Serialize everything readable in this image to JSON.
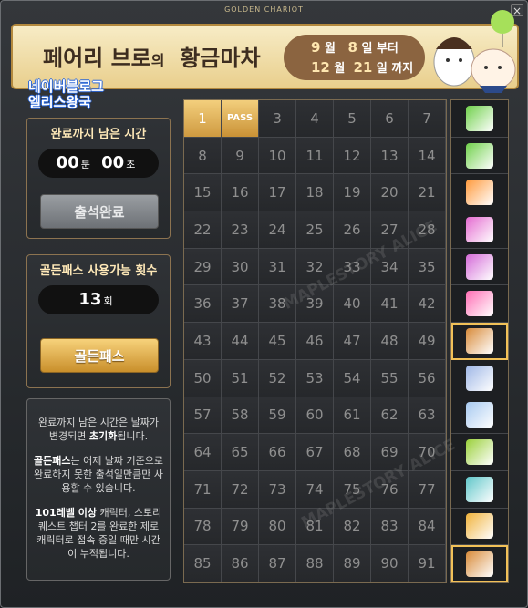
{
  "window": {
    "title": "GOLDEN CHARIOT",
    "close": "×"
  },
  "banner": {
    "title_a": "페어리 브로",
    "title_of": "의",
    "title_b": "황금마차",
    "start_month": "9",
    "start_day": "8",
    "start_suffix": "일 부터",
    "end_month": "12",
    "end_day": "21",
    "end_suffix": "일 까지",
    "month_unit": "월"
  },
  "watermark": {
    "line1": "네이버블로그",
    "line2": "엘리스왕국",
    "diag": "MAPLESTORY ALICE",
    "diag2": "네이버 블로그 엘리스왕국"
  },
  "timer_panel": {
    "heading": "완료까지 남은 시간",
    "minutes": "00",
    "minutes_unit": "분",
    "seconds": "00",
    "seconds_unit": "초",
    "button": "출석완료"
  },
  "pass_panel": {
    "heading": "골든패스 사용가능 횟수",
    "count": "13",
    "count_unit": "회",
    "button": "골든패스"
  },
  "info": {
    "p1": "완료까지 남은 시간은 날짜가 변경되면 ",
    "p1_bold": "초기화",
    "p1_end": "됩니다.",
    "p2_bold": "골든패스",
    "p2": "는 어제 날짜 기준으로 완료하지 못한 출석일만큼만 사용할 수 있습니다.",
    "p3_bold": "101레벨 이상",
    "p3": " 캐릭터, 스토리 퀘스트 챕터 2를 완료한 제로 캐릭터로 접속 중일 때만 시간이 누적됩니다."
  },
  "calendar": {
    "pass_label": "PASS",
    "days": [
      "1",
      "PASS",
      "3",
      "4",
      "5",
      "6",
      "7",
      "8",
      "9",
      "10",
      "11",
      "12",
      "13",
      "14",
      "15",
      "16",
      "17",
      "18",
      "19",
      "20",
      "21",
      "22",
      "23",
      "24",
      "25",
      "26",
      "27",
      "28",
      "29",
      "30",
      "31",
      "32",
      "33",
      "34",
      "35",
      "36",
      "37",
      "38",
      "39",
      "40",
      "41",
      "42",
      "43",
      "44",
      "45",
      "46",
      "47",
      "48",
      "49",
      "50",
      "51",
      "52",
      "53",
      "54",
      "55",
      "56",
      "57",
      "58",
      "59",
      "60",
      "61",
      "62",
      "63",
      "64",
      "65",
      "66",
      "67",
      "68",
      "69",
      "70",
      "71",
      "72",
      "73",
      "74",
      "75",
      "76",
      "77",
      "78",
      "79",
      "80",
      "81",
      "82",
      "83",
      "84",
      "85",
      "86",
      "87",
      "88",
      "89",
      "90",
      "91"
    ],
    "completed": [
      1,
      2
    ]
  },
  "rewards": [
    {
      "icon": "green-ticket-icon",
      "color": "#6fd04a",
      "highlight": false
    },
    {
      "icon": "green-ticket-icon",
      "color": "#6fd04a",
      "highlight": false
    },
    {
      "icon": "coupon-card-icon",
      "color": "#ff9a3c",
      "highlight": false
    },
    {
      "icon": "potion-vial-icon",
      "color": "#e46bd0",
      "highlight": false
    },
    {
      "icon": "pink-ticket-icon",
      "color": "#d46bd8",
      "highlight": false
    },
    {
      "icon": "pink-ticket-icon",
      "color": "#ff6fb5",
      "highlight": false
    },
    {
      "icon": "scroll-icon",
      "color": "#d88b3a",
      "highlight": true
    },
    {
      "icon": "ring-icon",
      "color": "#9fb7e6",
      "highlight": false
    },
    {
      "icon": "crystal-card-icon",
      "color": "#a7c9f0",
      "highlight": false
    },
    {
      "icon": "treasure-chest-icon",
      "color": "#9ad03a",
      "highlight": false
    },
    {
      "icon": "sword-icon",
      "color": "#5fc6c9",
      "highlight": false
    },
    {
      "icon": "yellow-ticket-icon",
      "color": "#f0b23a",
      "highlight": false
    },
    {
      "icon": "scroll-icon",
      "color": "#d88b3a",
      "highlight": true
    }
  ]
}
